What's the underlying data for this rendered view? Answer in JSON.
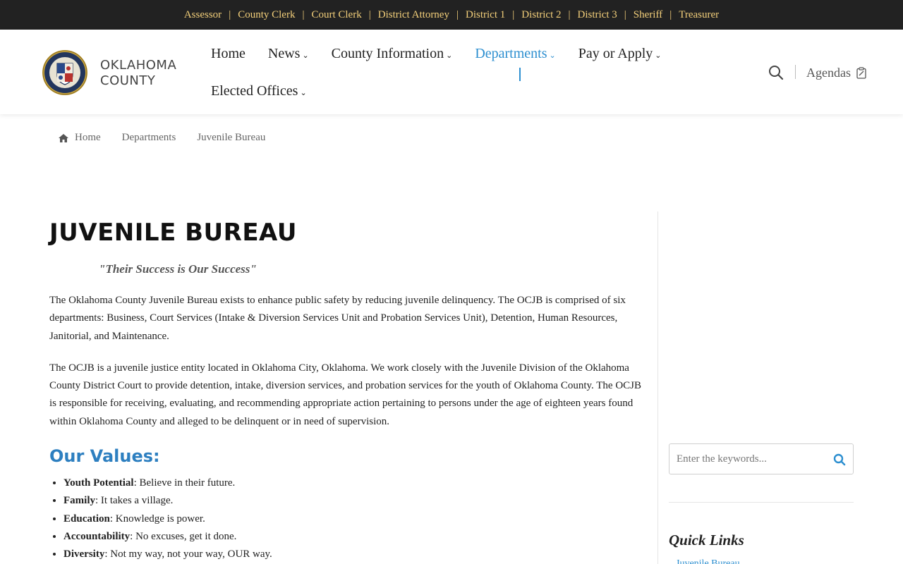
{
  "topbar": {
    "links": [
      "Assessor",
      "County Clerk",
      "Court Clerk",
      "District Attorney",
      "District 1",
      "District 2",
      "District 3",
      "Sheriff",
      "Treasurer"
    ],
    "separator": "|"
  },
  "header": {
    "logo_line1": "OKLAHOMA",
    "logo_line2": "COUNTY",
    "nav_row1": [
      {
        "label": "Home",
        "dropdown": false
      },
      {
        "label": "News",
        "dropdown": true
      },
      {
        "label": "County Information",
        "dropdown": true
      },
      {
        "label": "Departments",
        "dropdown": true,
        "active": true
      },
      {
        "label": "Pay or Apply",
        "dropdown": true
      }
    ],
    "nav_row2": [
      {
        "label": "Elected Offices",
        "dropdown": true
      }
    ],
    "agendas_label": "Agendas"
  },
  "breadcrumb": [
    "Home",
    "Departments",
    "Juvenile Bureau"
  ],
  "main": {
    "title": "JUVENILE BUREAU",
    "tagline": "\"Their Success is Our Success\"",
    "para1": "The Oklahoma County Juvenile Bureau exists to enhance public safety by reducing juvenile delinquency. The OCJB is comprised of six departments: Business, Court Services (Intake & Diversion Services Unit and Probation Services Unit), Detention, Human Resources, Janitorial, and Maintenance.",
    "para2": "The OCJB is a juvenile justice entity located in Oklahoma City, Oklahoma. We work closely with the Juvenile Division of the Oklahoma County District Court to provide detention, intake, diversion services, and probation services for the youth of Oklahoma County. The OCJB is responsible for receiving, evaluating, and recommending appropriate action pertaining to persons under the age of eighteen years found within Oklahoma County and alleged to be delinquent or in need of supervision.",
    "values_title": "Our Values:",
    "values": [
      {
        "term": "Youth Potential",
        "desc": ": Believe in their future."
      },
      {
        "term": "Family",
        "desc": ": It takes a village."
      },
      {
        "term": "Education",
        "desc": ": Knowledge is power."
      },
      {
        "term": "Accountability",
        "desc": ": No excuses, get it done."
      },
      {
        "term": "Diversity",
        "desc": ": Not my way, not your way, OUR way."
      }
    ]
  },
  "sidebar": {
    "search_placeholder": "Enter the keywords...",
    "quick_links_title": "Quick Links",
    "quick_link_1": "Juvenile Bureau"
  },
  "colors": {
    "topbar_bg": "#222222",
    "topbar_link": "#f3cf7a",
    "accent": "#2d8fd0",
    "values_heading": "#2d7fc0"
  },
  "icons": [
    "home-icon",
    "search-icon",
    "clipboard-icon",
    "chevron-down-icon"
  ]
}
